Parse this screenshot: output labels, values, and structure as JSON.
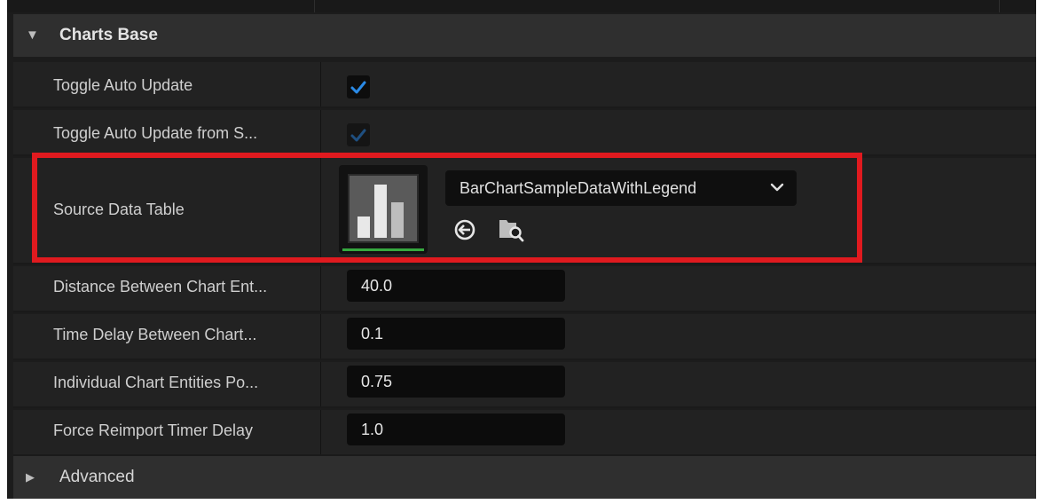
{
  "section_header": {
    "title": "Charts Base",
    "expanded": true
  },
  "properties": {
    "toggle_auto_update": {
      "label": "Toggle Auto Update",
      "checked": true
    },
    "toggle_auto_update_from_source": {
      "label": "Toggle Auto Update from S...",
      "checked": true,
      "disabled": true
    },
    "source_data_table": {
      "label": "Source Data Table",
      "asset_name": "BarChartSampleDataWithLegend",
      "thumbnail_icon": "bar-chart-icon",
      "browse_icon": "use-selected-arrow-icon",
      "find_icon": "browse-folder-search-icon"
    },
    "distance_between_chart_entities": {
      "label": "Distance Between Chart Ent...",
      "value": "40.0"
    },
    "time_delay_between_chart": {
      "label": "Time Delay Between Chart...",
      "value": "0.1"
    },
    "individual_chart_entities_position": {
      "label": "Individual Chart Entities Po...",
      "value": "0.75"
    },
    "force_reimport_timer_delay": {
      "label": "Force Reimport Timer Delay",
      "value": "1.0"
    }
  },
  "advanced_header": {
    "title": "Advanced",
    "expanded": false
  },
  "colors": {
    "panel_bg": "#1c1c1c",
    "row_bg": "#222222",
    "header_bg": "#2f2f2f",
    "check_accent": "#2a8ae6",
    "highlight_border": "#e01a1f",
    "thumbnail_underline": "#36a93f"
  }
}
